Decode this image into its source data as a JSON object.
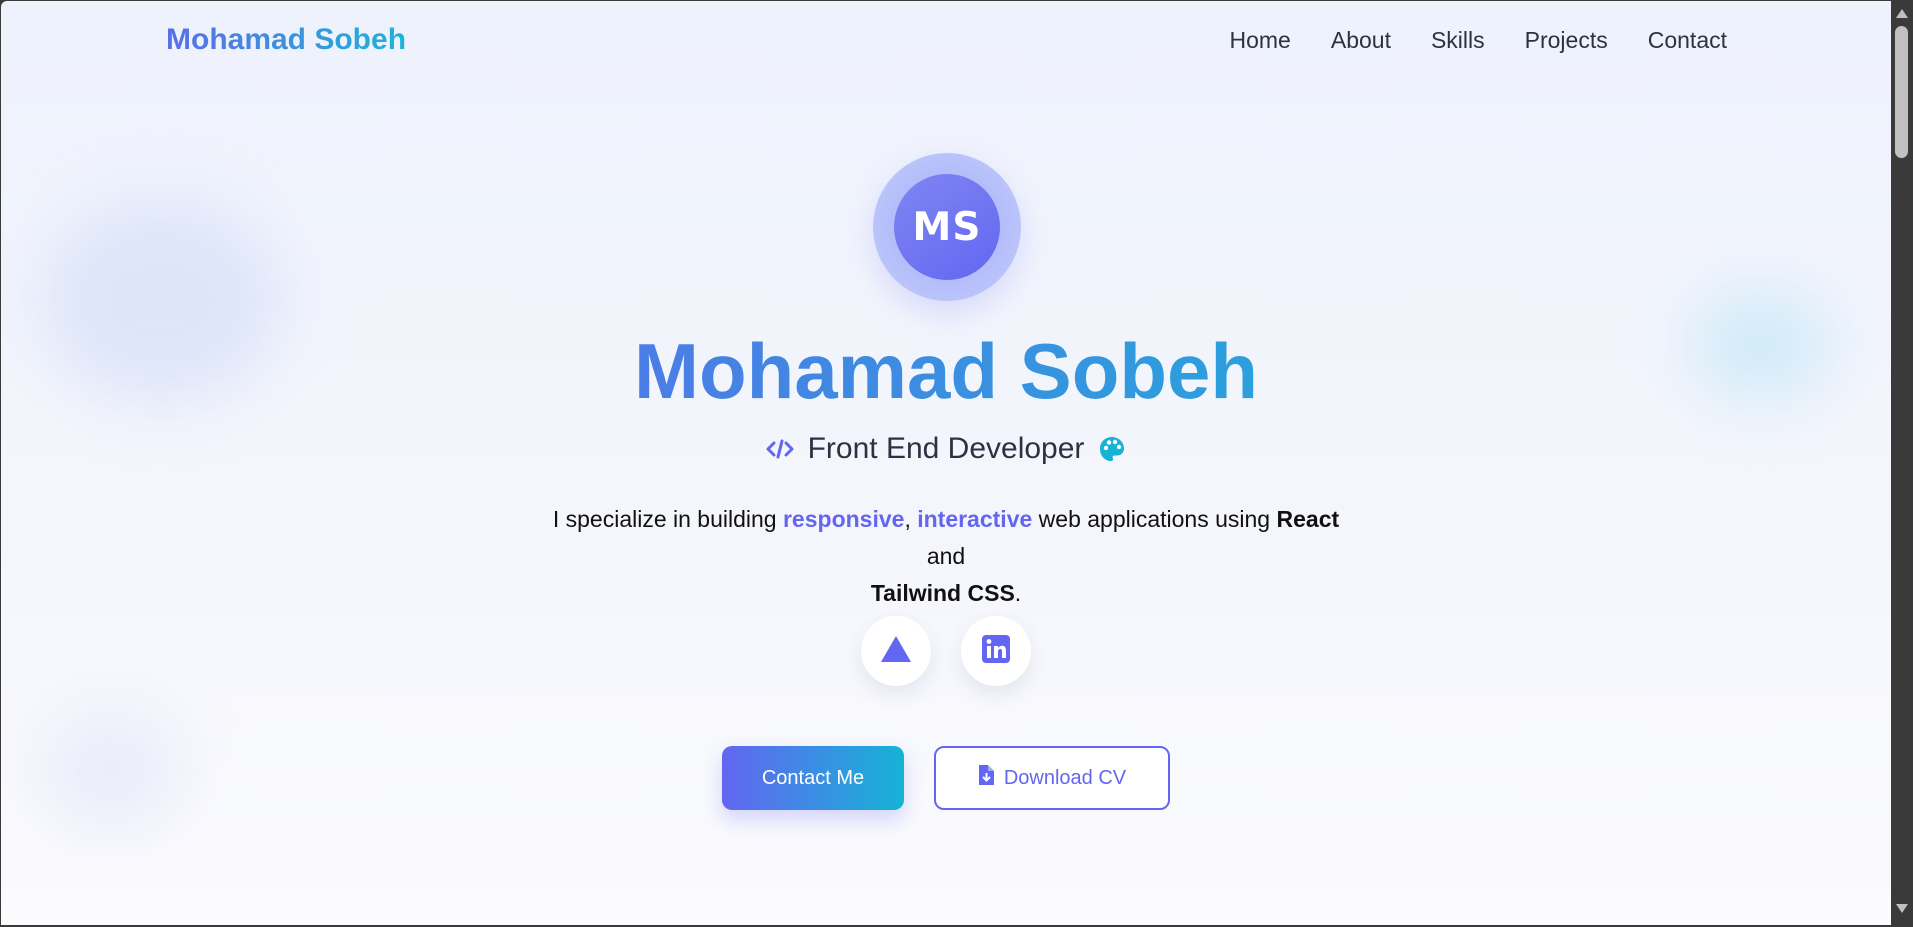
{
  "nav": {
    "brand": "Mohamad Sobeh",
    "links": [
      "Home",
      "About",
      "Skills",
      "Projects",
      "Contact"
    ]
  },
  "hero": {
    "initials": "MS",
    "name": "Mohamad Sobeh",
    "role": "Front End Developer",
    "role_icon_left": "code-icon",
    "role_icon_right": "palette-icon",
    "tagline": {
      "t1": "I specialize in building ",
      "h1": "responsive",
      "t2": ", ",
      "h2": "interactive",
      "t3": " web applications using ",
      "b1": "React",
      "t4": " and ",
      "b2": "Tailwind CSS",
      "t5": "."
    },
    "socials": [
      "vercel-icon",
      "linkedin-icon"
    ],
    "cta_primary": "Contact Me",
    "cta_secondary": "Download CV",
    "cta_secondary_icon": "file-download-icon"
  },
  "colors": {
    "accent": "#6366f1",
    "accent_cyan": "#15b3d6",
    "text": "#2d3142"
  }
}
